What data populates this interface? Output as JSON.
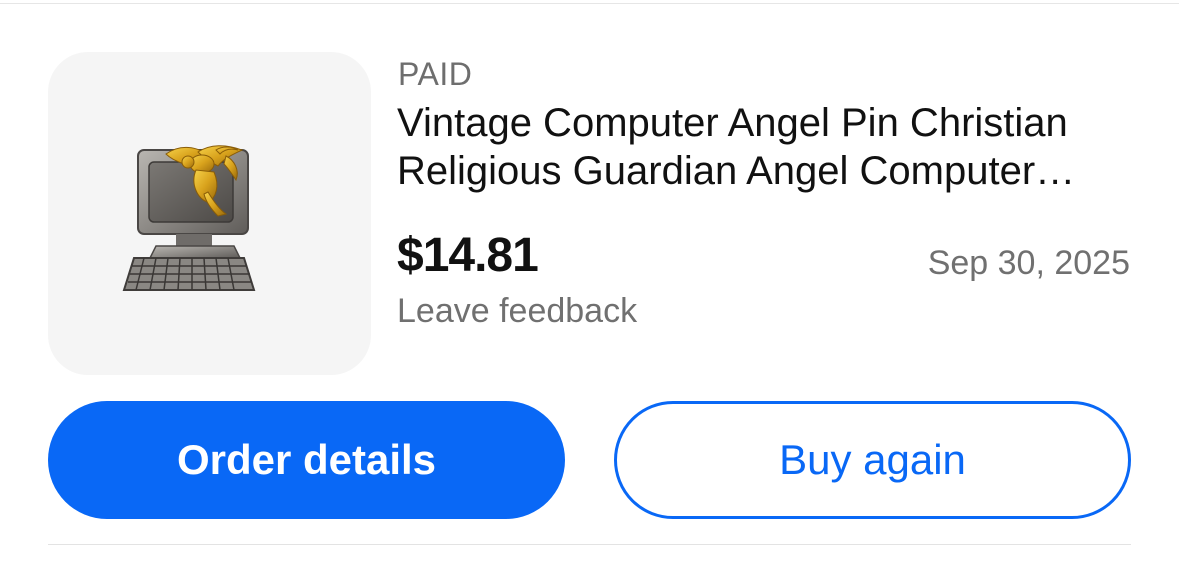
{
  "order": {
    "status": "PAID",
    "title": "Vintage Computer Angel Pin Christian Religious Guardian Angel Computer Lapel Pin",
    "price": "$14.81",
    "date": "Sep 30, 2025",
    "feedback_link": "Leave feedback",
    "image": "product-thumbnail"
  },
  "actions": {
    "order_details_label": "Order details",
    "buy_again_label": "Buy again"
  },
  "colors": {
    "accent": "#0968f6",
    "text_primary": "#111111",
    "text_secondary": "#707070",
    "thumbnail_bg": "#f5f5f5"
  }
}
